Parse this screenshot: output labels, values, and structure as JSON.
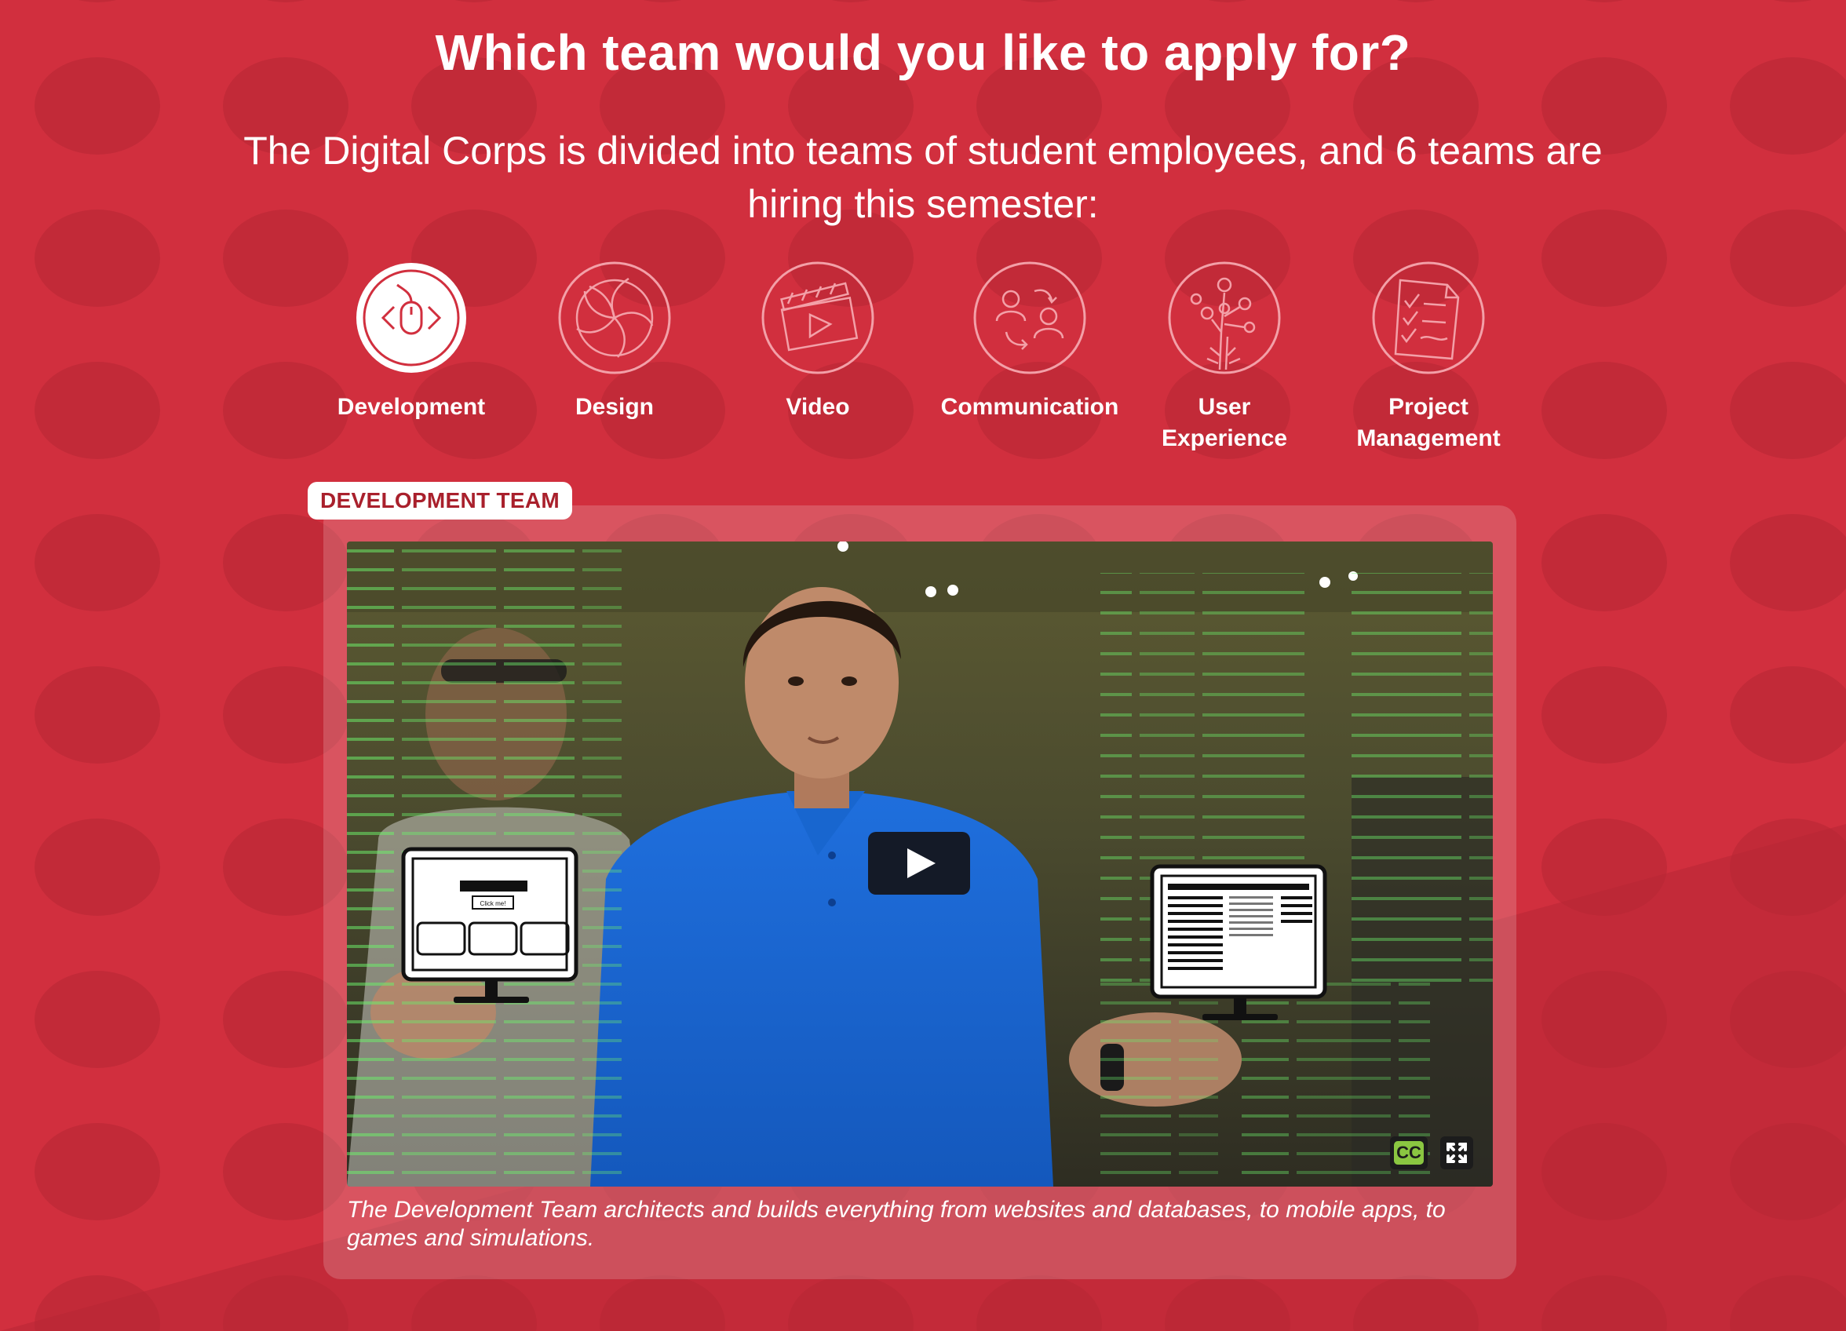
{
  "page": {
    "headline": "Which team would you like to apply for?",
    "intro": "The Digital Corps is divided into teams of student employees, and 6 teams are hiring this semester:"
  },
  "teams": [
    {
      "label": "Development",
      "icon": "code-mouse-icon",
      "selected": true
    },
    {
      "label": "Design",
      "icon": "flower-swirl-icon",
      "selected": false
    },
    {
      "label": "Video",
      "icon": "clapper-play-icon",
      "selected": false
    },
    {
      "label": "Communication",
      "icon": "people-exchange-icon",
      "selected": false
    },
    {
      "label": "User Experience",
      "icon": "tree-nodes-icon",
      "selected": false
    },
    {
      "label": "Project Management",
      "icon": "checklist-clipboard-icon",
      "selected": false
    }
  ],
  "selected_team": {
    "badge": "DEVELOPMENT TEAM",
    "caption": "The Development Team architects and builds everything from websites and databases, to mobile apps, to games and simulations.",
    "video": {
      "monitor_button_text": "Click me!",
      "cc_label": "CC",
      "play_icon": "play-icon",
      "fullscreen_icon": "fullscreen-icon"
    }
  },
  "colors": {
    "background": "#d12f3e",
    "badge_text": "#a9202c",
    "cc_green": "#8ac641",
    "code_green": "#6cf06a"
  }
}
